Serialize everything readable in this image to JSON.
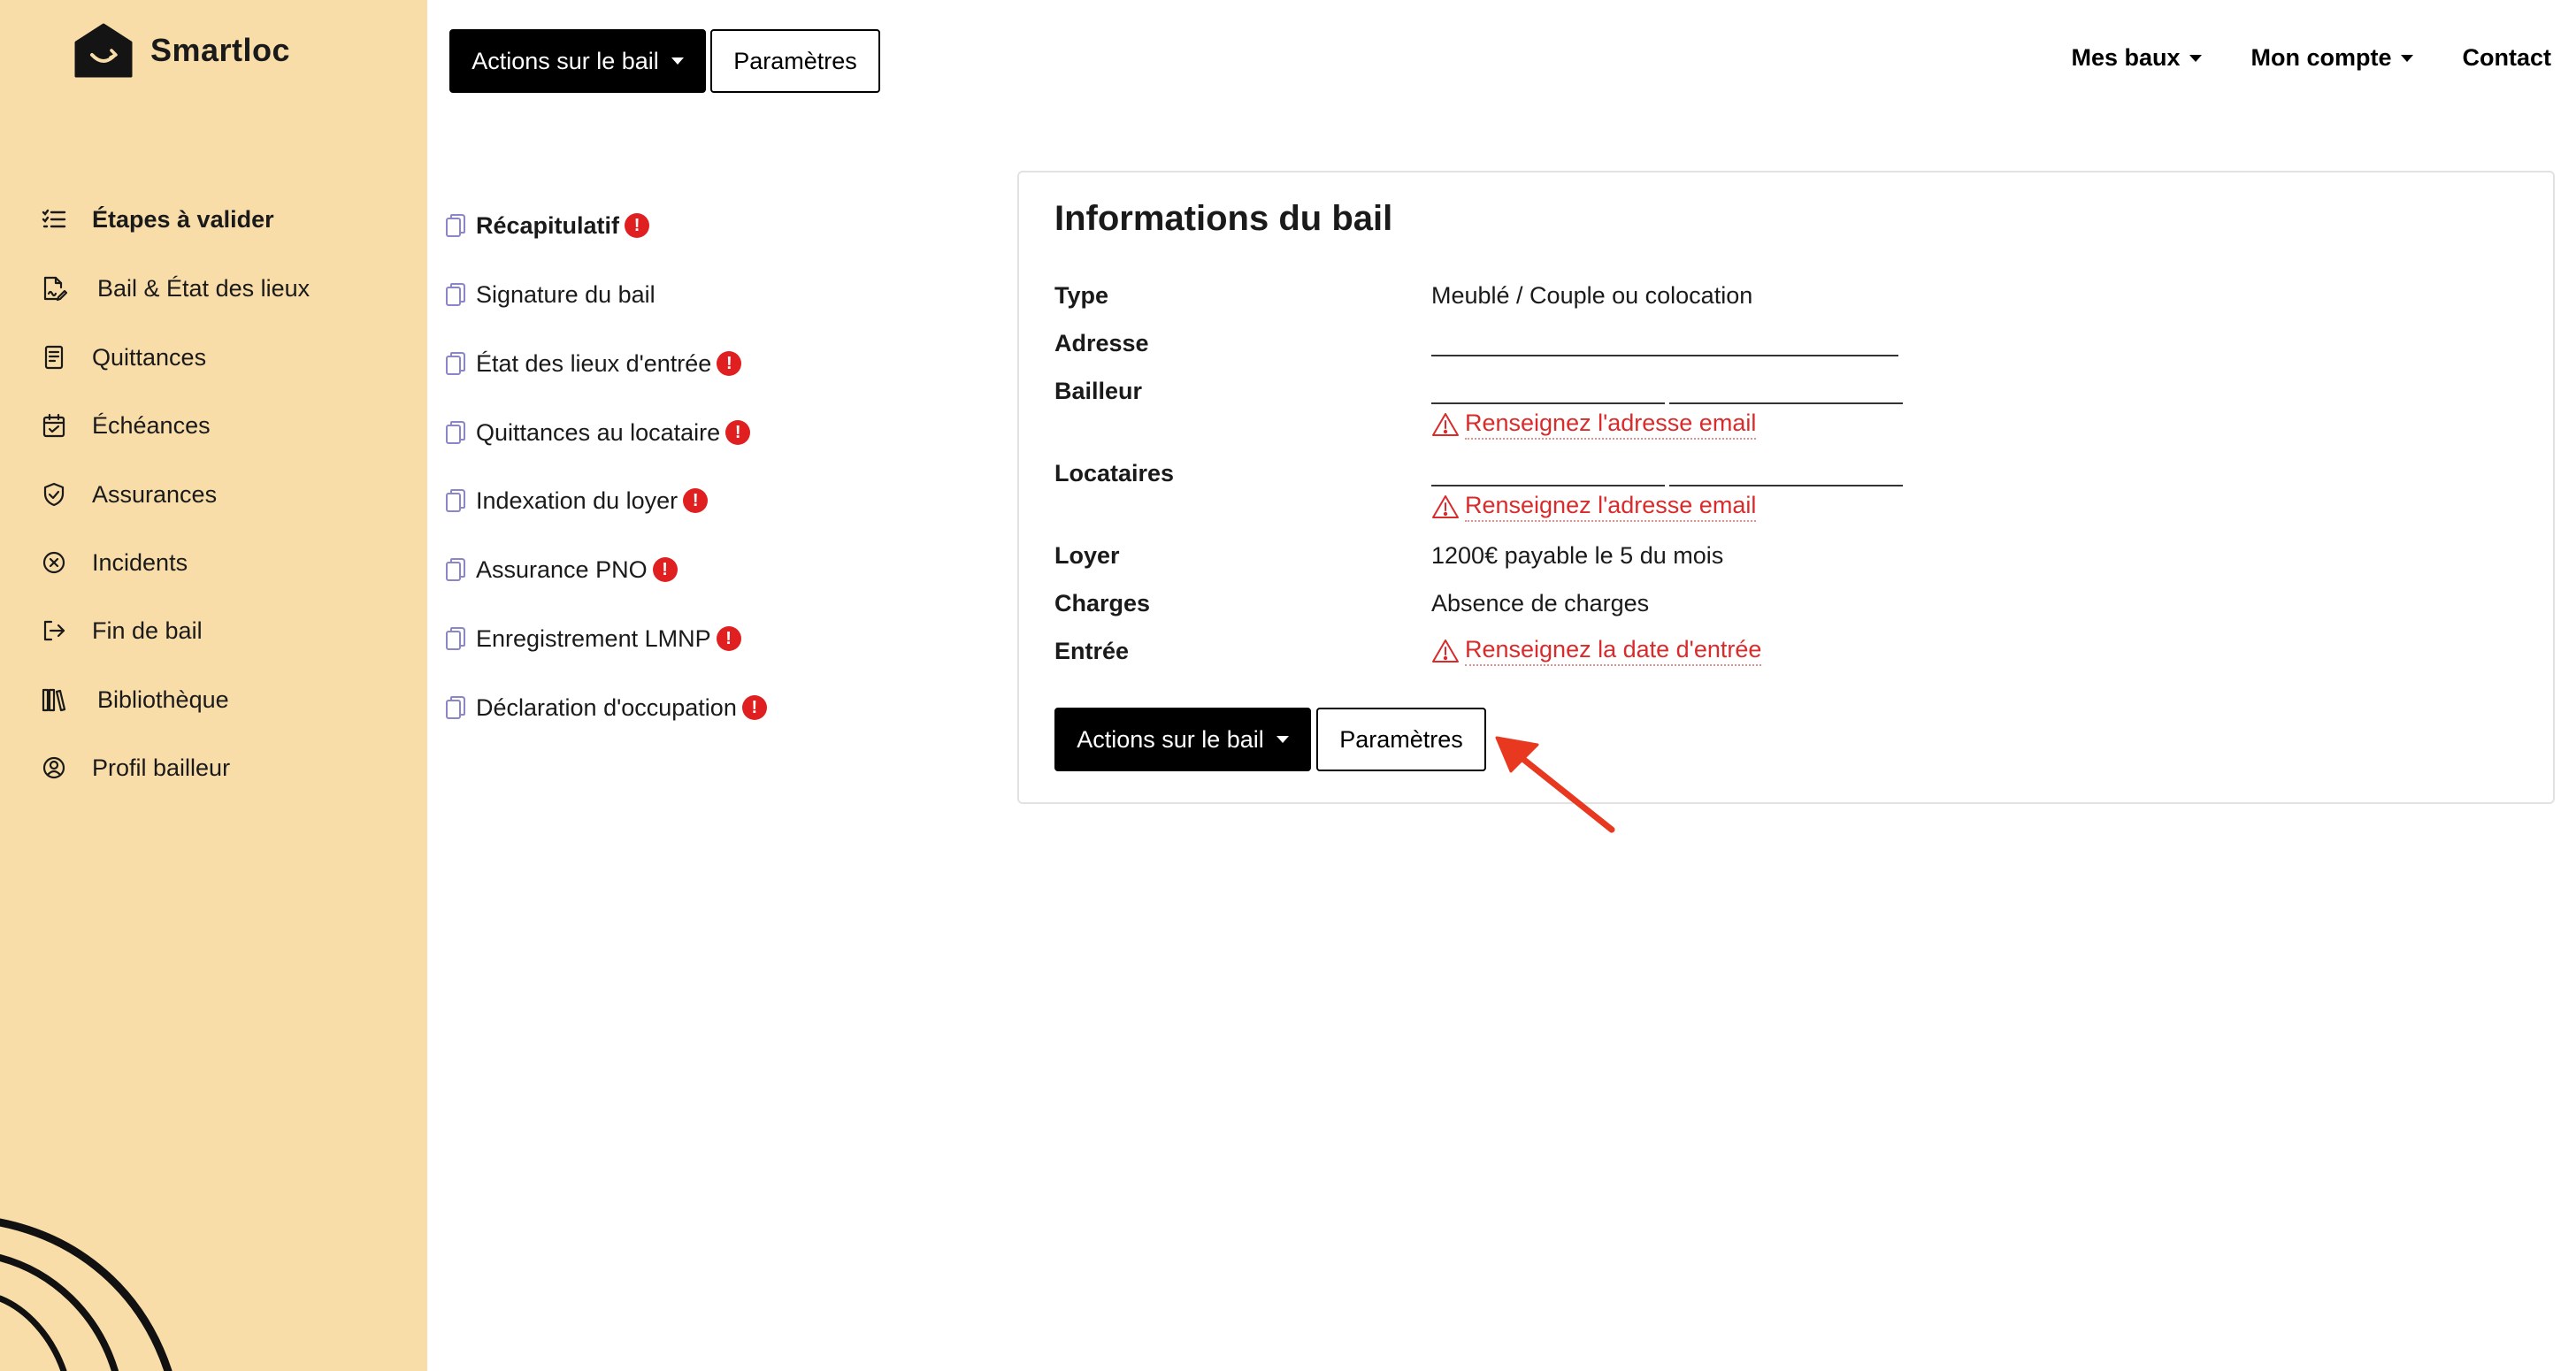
{
  "brand": {
    "name": "Smartloc"
  },
  "sidebar": {
    "items": [
      {
        "label": "Étapes à valider",
        "icon": "checklist-icon",
        "active": true
      },
      {
        "label": "Bail & État des lieux",
        "icon": "signed-document-icon",
        "active": false
      },
      {
        "label": "Quittances",
        "icon": "receipt-icon",
        "active": false
      },
      {
        "label": "Échéances",
        "icon": "calendar-check-icon",
        "active": false
      },
      {
        "label": "Assurances",
        "icon": "shield-check-icon",
        "active": false
      },
      {
        "label": "Incidents",
        "icon": "x-circle-icon",
        "active": false
      },
      {
        "label": "Fin de bail",
        "icon": "exit-icon",
        "active": false
      },
      {
        "label": "Bibliothèque",
        "icon": "library-icon",
        "active": false
      },
      {
        "label": "Profil bailleur",
        "icon": "user-circle-icon",
        "active": false
      }
    ]
  },
  "toolbar": {
    "actions_label": "Actions sur le bail",
    "settings_label": "Paramètres"
  },
  "topnav": {
    "leases": "Mes baux",
    "account": "Mon compte",
    "contact": "Contact"
  },
  "steps": [
    {
      "label": "Récapitulatif",
      "alert": true,
      "active": true
    },
    {
      "label": "Signature du bail",
      "alert": false,
      "active": false
    },
    {
      "label": "État des lieux d'entrée",
      "alert": true,
      "active": false
    },
    {
      "label": "Quittances au locataire",
      "alert": true,
      "active": false
    },
    {
      "label": "Indexation du loyer",
      "alert": true,
      "active": false
    },
    {
      "label": "Assurance PNO",
      "alert": true,
      "active": false
    },
    {
      "label": "Enregistrement LMNP",
      "alert": true,
      "active": false
    },
    {
      "label": "Déclaration d'occupation",
      "alert": true,
      "active": false
    }
  ],
  "alert_mark": "!",
  "lease_info": {
    "title": "Informations du bail",
    "type_label": "Type",
    "type_value": "Meublé / Couple ou colocation",
    "address_label": "Adresse",
    "landlord_label": "Bailleur",
    "landlord_warning": "Renseignez l'adresse email",
    "tenants_label": "Locataires",
    "tenants_warning": "Renseignez l'adresse email",
    "rent_label": "Loyer",
    "rent_value": "1200€ payable le 5 du mois",
    "charges_label": "Charges",
    "charges_value": "Absence de charges",
    "entry_label": "Entrée",
    "entry_warning": "Renseignez la date d'entrée",
    "actions_label": "Actions sur le bail",
    "settings_label": "Paramètres"
  },
  "colors": {
    "sidebar_bg": "#f9dda9",
    "warning": "#d92b2b",
    "alert_badge": "#e02020",
    "annotation_arrow": "#e8381f",
    "doc_icon": "#8a86c8"
  }
}
